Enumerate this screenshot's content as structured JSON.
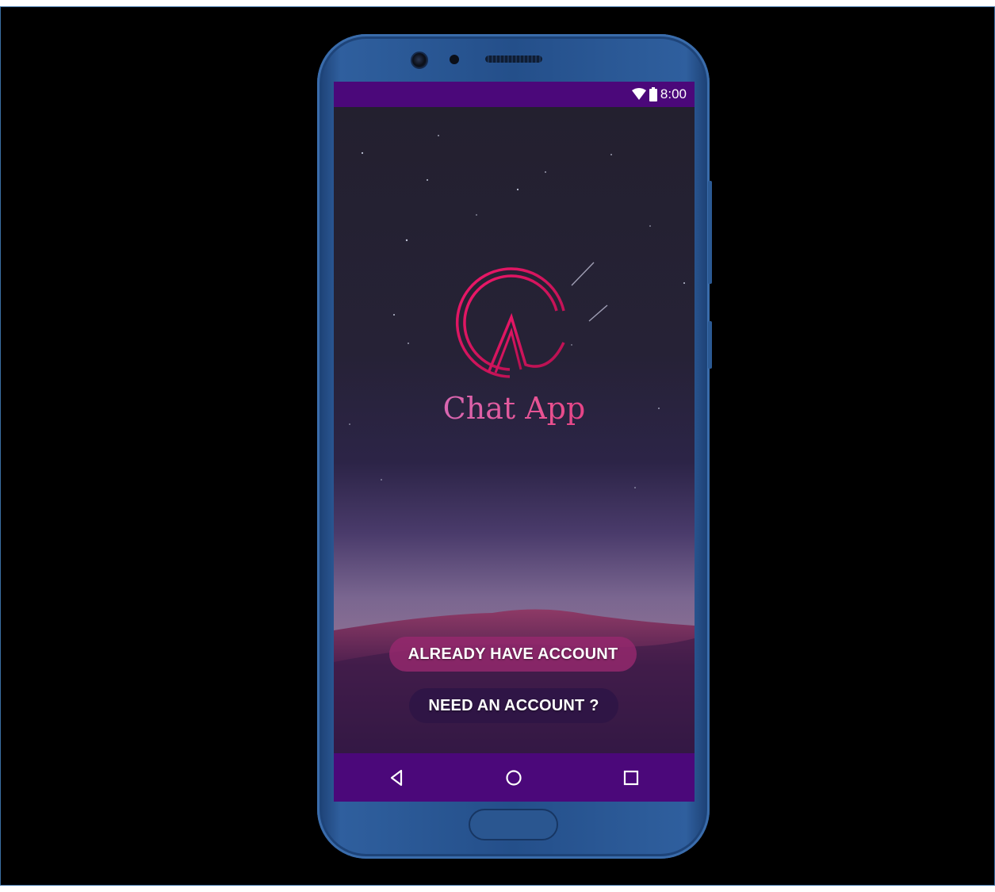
{
  "status_bar": {
    "icons": [
      "wifi-icon",
      "battery-icon"
    ],
    "time": "8:00"
  },
  "app": {
    "logo_icon": "chat-app-logo-icon",
    "name": "Chat App",
    "buttons": {
      "login": "ALREADY HAVE ACCOUNT",
      "register": "NEED AN ACCOUNT ?"
    }
  },
  "nav_bar": {
    "items": [
      "back-icon",
      "home-icon",
      "recents-icon"
    ]
  },
  "colors": {
    "status_bar": "#4b087a",
    "nav_bar": "#4b087a",
    "logo_accent": "#e21660",
    "login_button": "#96286e",
    "register_button": "#2d1446",
    "phone_body": "#2f5f9e"
  }
}
